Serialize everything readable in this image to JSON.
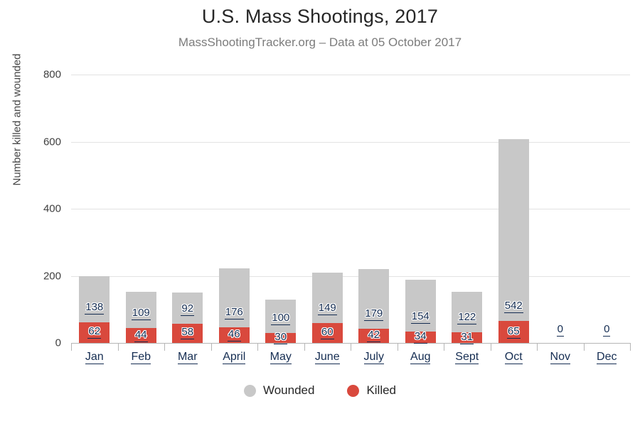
{
  "chart_data": {
    "type": "bar",
    "subtype": "stacked-bar",
    "title": "U.S. Mass Shootings, 2017",
    "subtitle": "MassShootingTracker.org – Data at 05 October 2017",
    "xlabel": "",
    "ylabel": "Number killed and wounded",
    "ylim": [
      0,
      800
    ],
    "yticks": [
      0,
      200,
      400,
      600,
      800
    ],
    "ytick_labels": [
      "0",
      "200",
      "400",
      "600",
      "800"
    ],
    "grid": true,
    "grid_axis": "y",
    "legend_position": "bottom",
    "categories": [
      "Jan",
      "Feb",
      "Mar",
      "April",
      "May",
      "June",
      "July",
      "Aug",
      "Sept",
      "Oct",
      "Nov",
      "Dec"
    ],
    "series": [
      {
        "name": "Killed",
        "color": "#d9493d",
        "values": [
          62,
          44,
          58,
          46,
          30,
          60,
          42,
          34,
          31,
          65,
          0,
          0
        ]
      },
      {
        "name": "Wounded",
        "color": "#c8c8c8",
        "values": [
          138,
          109,
          92,
          176,
          100,
          149,
          179,
          154,
          122,
          542,
          0,
          0
        ]
      }
    ],
    "totals": [
      200,
      153,
      150,
      222,
      130,
      209,
      221,
      188,
      153,
      607,
      0,
      0
    ],
    "zero_label": "0"
  },
  "legend": {
    "items": [
      {
        "label": "Wounded",
        "color": "#c8c8c8",
        "marker": "circle"
      },
      {
        "label": "Killed",
        "color": "#d9493d",
        "marker": "circle"
      }
    ]
  },
  "colors": {
    "wounded": "#c8c8c8",
    "killed": "#d9493d",
    "label_text": "#152d52",
    "gridline": "#e3e3e3",
    "axis": "#b6b6b6",
    "title": "#262626",
    "subtitle": "#7c7c7c",
    "background": "#ffffff"
  }
}
